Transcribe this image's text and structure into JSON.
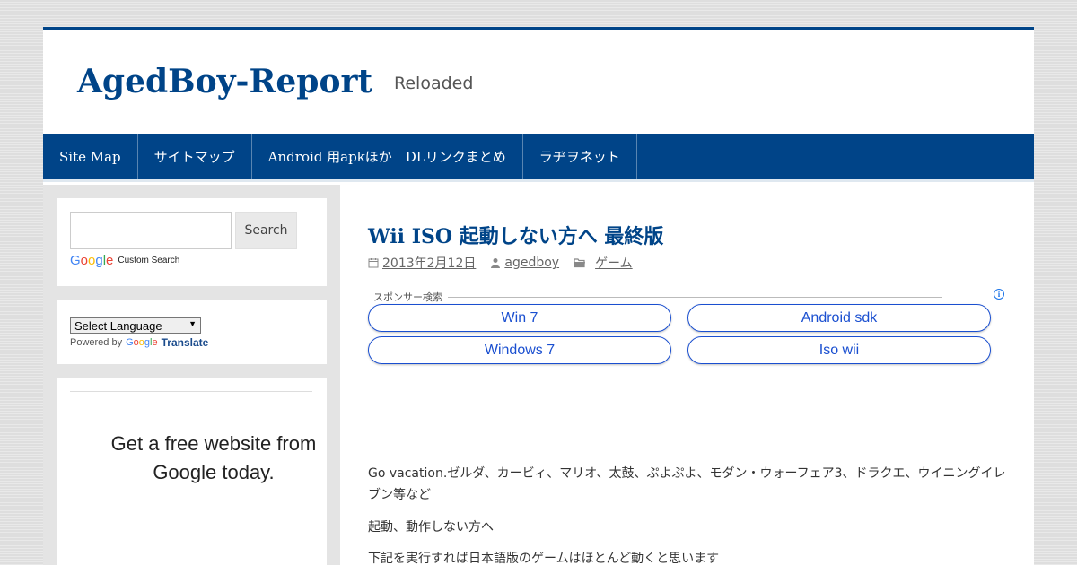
{
  "header": {
    "site_title": "AgedBoy-Report",
    "site_description": "Reloaded"
  },
  "nav": {
    "items": [
      {
        "label": "Site Map"
      },
      {
        "label": "サイトマップ"
      },
      {
        "label": "Android 用apkほか　DLリンクまとめ"
      },
      {
        "label": "ラヂヲネット"
      }
    ]
  },
  "sidebar": {
    "search": {
      "placeholder": "",
      "button_label": "Search",
      "google_logo": "Google",
      "custom_search_label": "Custom Search"
    },
    "translate": {
      "select_value": "Select Language",
      "powered_by": "Powered by",
      "google_logo": "Google",
      "translate_label": "Translate"
    },
    "ad": {
      "text_line1": "Get a free website from",
      "text_line2": "Google today."
    }
  },
  "post": {
    "title": "Wii ISO 起動しない方へ 最終版",
    "date": "2013年2月12日",
    "author": "agedboy",
    "category": "ゲーム",
    "sponsor_label": "スポンサー検索",
    "ad_links": [
      "Win 7",
      "Android sdk",
      "Windows 7",
      "Iso wii"
    ],
    "paragraphs": [
      "Go vacation.ゼルダ、カービィ、マリオ、太鼓、ぷよぷよ、モダン・ウォーフェア3、ドラクエ、ウイニングイレブン等など",
      "起動、動作しない方へ",
      "下記を実行すれば日本語版のゲームはほとんど動くと思います"
    ]
  },
  "colors": {
    "brand_blue": "#004488",
    "ad_link_blue": "#1a4fd0"
  }
}
